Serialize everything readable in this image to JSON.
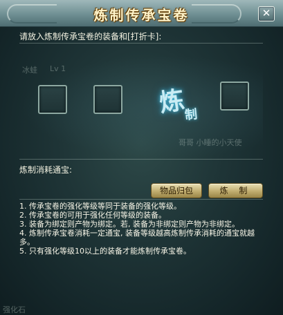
{
  "window": {
    "title": "炼制传承宝卷",
    "close_label": "✕"
  },
  "slots_section": {
    "prompt": "请放入炼制传承宝卷的装备和[打折卡]:",
    "faint_label_left": "冰蛙",
    "faint_label_right": "Lv 1",
    "faint_bottom_text": "哥哥   小睡的小天使",
    "calligraphy_main": "炼",
    "calligraphy_sub": "制",
    "slots": [
      {
        "name": "equipment-slot-1",
        "content": ""
      },
      {
        "name": "equipment-slot-2",
        "content": ""
      },
      {
        "name": "discount-card-slot",
        "content": ""
      }
    ]
  },
  "cost": {
    "label": "炼制消耗通宝:",
    "value": ""
  },
  "buttons": {
    "reclaim": "物品归包",
    "refine": "炼 制"
  },
  "notes": [
    "1. 传承宝卷的强化等级等同于装备的强化等级。",
    "2. 传承宝卷的可用于强化任何等级的装备。",
    "3. 装备为绑定则产物为绑定。若, 装备为非绑定则产物为非绑定。",
    "4. 炼制传承宝卷消耗一定通宝, 装备等级越高炼制传承消耗的通宝就越多。",
    "5. 只有强化等级10以上的装备才能炼制传承宝卷。"
  ],
  "bottom_faint": "强化石",
  "colors": {
    "title_gold": "#fff4ca",
    "panel_teal": "#1f3537",
    "button_gold": "#c0ad6f",
    "calligraphy_glow": "#4ac0e0"
  },
  "icons": {
    "close": "close-icon"
  }
}
